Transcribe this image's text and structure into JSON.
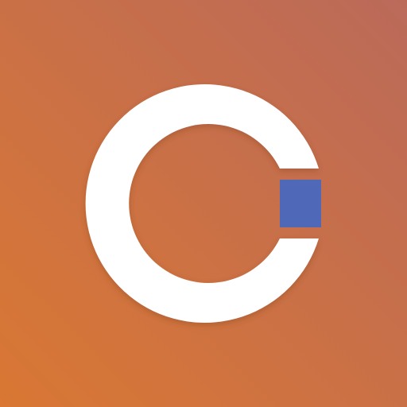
{
  "app_icon": {
    "name": "c-logo-icon",
    "colors": {
      "background_gradient_start": "#D97733",
      "background_gradient_end": "#BB6A5A",
      "ring": "#FFFFFF",
      "accent_block": "#5068B8",
      "shadow": "#7A3A1A"
    }
  }
}
